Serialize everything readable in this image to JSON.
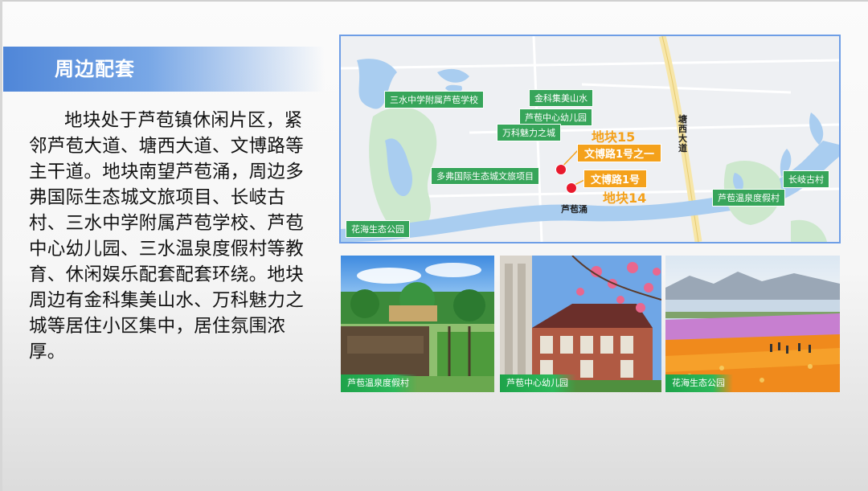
{
  "section": {
    "title": "周边配套"
  },
  "body": {
    "paragraph": "地块处于芦苞镇休闲片区，紧邻芦苞大道、塘西大道、文博路等主干道。地块南望芦苞涌，周边多弗国际生态城文旅项目、长岐古村、三水中学附属芦苞学校、芦苞中心幼儿园、三水温泉度假村等教育、休闲娱乐配套配套环绕。地块周边有金科集美山水、万科魅力之城等居住小区集中，居住氛围浓厚。"
  },
  "map": {
    "green_labels": {
      "school": "三水中学附属芦苞学校",
      "jinke": "金科集美山水",
      "kindergarten": "芦苞中心幼儿园",
      "vanke": "万科魅力之城",
      "dofo": "多弗国际生态城文旅项目",
      "changqi": "长岐古村",
      "hotspring": "芦苞温泉度假村",
      "flower_park": "花海生态公园"
    },
    "roads": {
      "tangxi": "塘西大道",
      "river": "芦苞涌"
    },
    "parcels": {
      "p15_name": "地块15",
      "p15_tag": "文博路1号之一",
      "p14_tag": "文博路1号",
      "p14_name": "地块14"
    },
    "colors": {
      "accent": "#f4a11b",
      "pin": "#e8192c",
      "label_green": "#37a55a",
      "water": "#a9cdf0",
      "green_area": "#cde8cd"
    }
  },
  "photos": [
    {
      "caption": "芦苞温泉度假村"
    },
    {
      "caption": "芦苞中心幼儿园"
    },
    {
      "caption": "花海生态公园"
    }
  ]
}
